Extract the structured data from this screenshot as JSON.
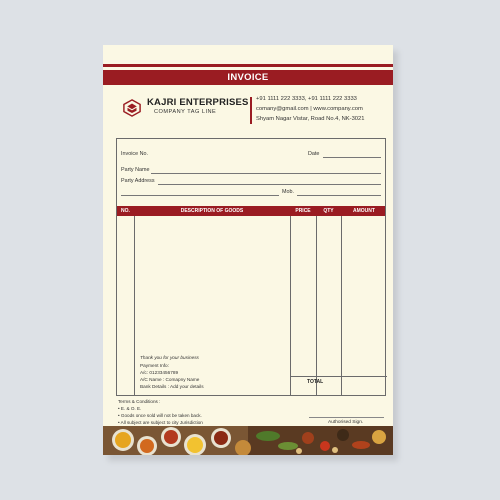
{
  "invoice": {
    "title": "INVOICE",
    "company": {
      "name": "KAJRI ENTERPRISES",
      "tagline": "COMPANY TAG LINE"
    },
    "contact": {
      "phones": "+91 1111 222 3333, +91 1111 222 3333",
      "email_web": "comany@gmail.com | www.company.com",
      "address": "Shyam Nagar Vistar, Road No.4, NK-3021"
    },
    "fields": {
      "invoice_no": "Invoice No.",
      "date": "Date",
      "party_name": "Party Name",
      "party_address": "Party Address",
      "mob": "Mob."
    },
    "table": {
      "headers": [
        "NO.",
        "DESCRIPTION OF GOODS",
        "PRICE",
        "QTY",
        "AMOUNT"
      ],
      "total_label": "TOTAL"
    },
    "notes": [
      "Thank you for your business",
      "Payment Info:",
      "A/c: 01233456789",
      "A/C Name : Comapny Name",
      "Bank Details : Add your details"
    ],
    "terms": [
      "Terms & Conditions :",
      "•  E. & O. E.",
      "• Goods once sold will not be taken back.",
      "• All subject are subject to city Jurisdiction"
    ],
    "signature": "Authorised Sign."
  },
  "colors": {
    "accent": "#9a1c22",
    "paper": "#fbf8e4",
    "background": "#dde1e6"
  },
  "icons": {
    "logo": "house-box-logo-icon",
    "spices": "spice-bowls-decoration"
  }
}
